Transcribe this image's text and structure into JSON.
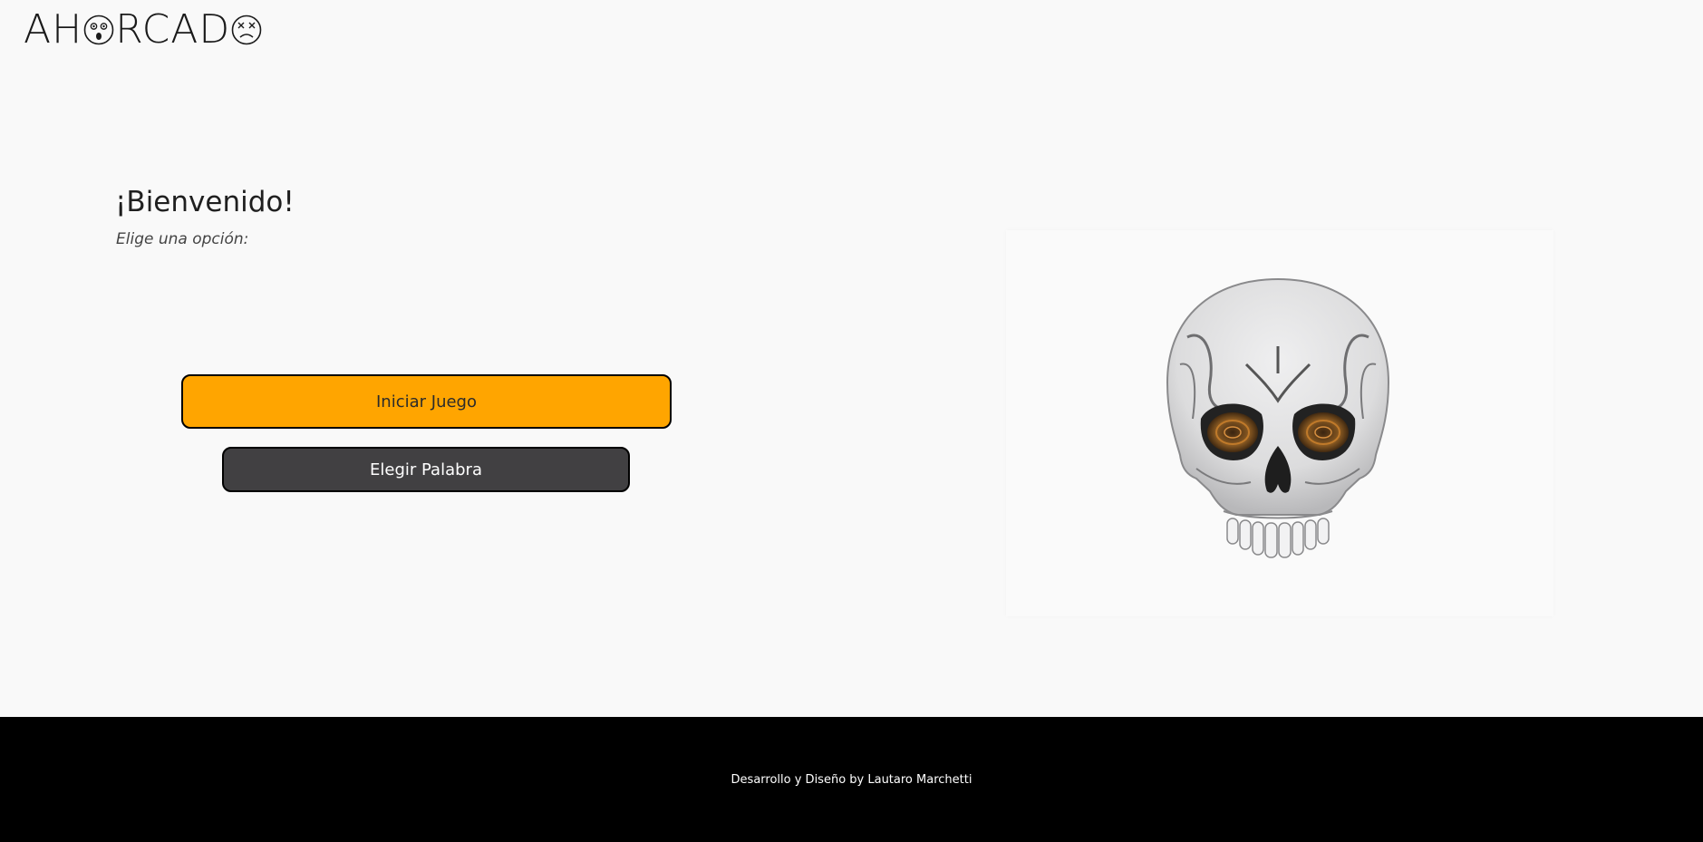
{
  "header": {
    "logo_prefix": "AH",
    "logo_suffix": "RCAD",
    "logo_icon_left": "shocked-face-icon",
    "logo_icon_right": "dead-face-icon"
  },
  "main": {
    "title": "¡Bienvenido!",
    "subtitle": "Elige una opción:",
    "buttons": {
      "start": "Iniciar Juego",
      "choose_word": "Elegir Palabra"
    },
    "illustration": "skull-icon"
  },
  "footer": {
    "credit": "Desarrollo y Diseño by Lautaro Marchetti"
  },
  "colors": {
    "background": "#f9f9f9",
    "accent": "#ffa500",
    "secondary_button": "#414042",
    "footer": "#000000"
  }
}
